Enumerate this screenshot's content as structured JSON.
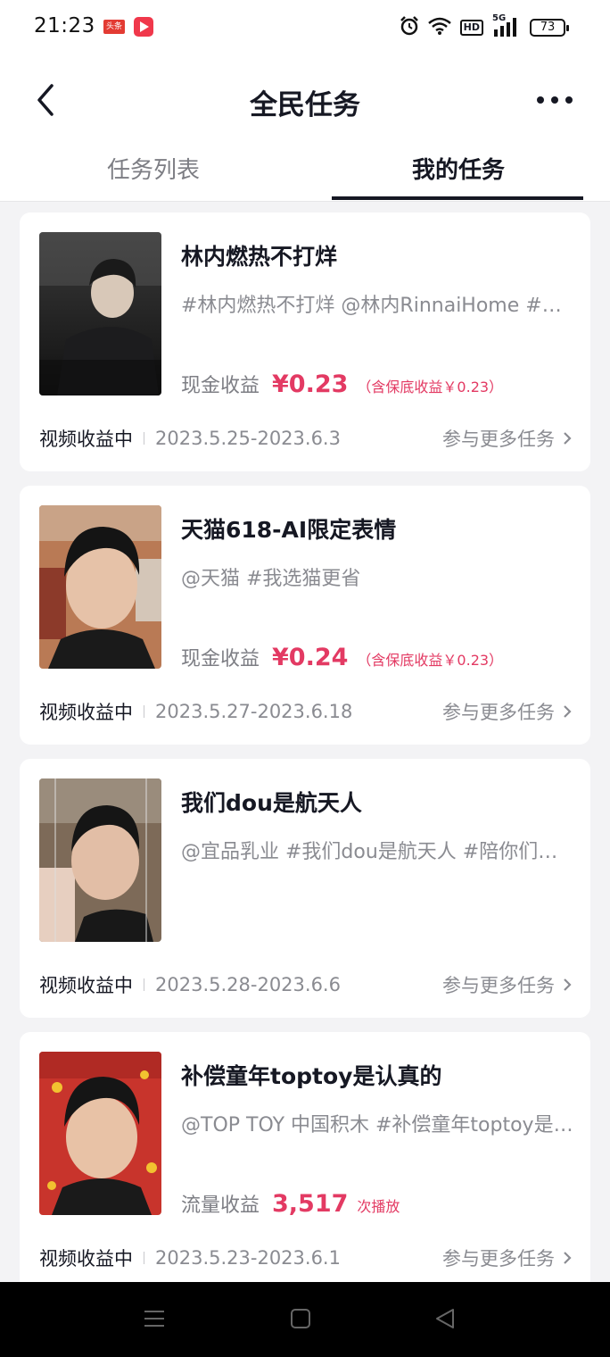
{
  "status_bar": {
    "time": "21:23",
    "app_icon_1_text": "头条",
    "signal": "5G",
    "hd": "HD",
    "battery": "73"
  },
  "header": {
    "title": "全民任务"
  },
  "tabs": [
    {
      "label": "任务列表",
      "active": false
    },
    {
      "label": "我的任务",
      "active": true
    }
  ],
  "tasks": [
    {
      "title": "林内燃热不打烊",
      "desc": "#林内燃热不打烊 @林内RinnaiHome #林内燃热不打烊",
      "earn_label": "现金收益",
      "earn_value": "¥0.23",
      "earn_note": "（含保底收益￥0.23）",
      "status": "视频收益中",
      "date_range": "2023.5.25-2023.6.3",
      "more_label": "参与更多任务"
    },
    {
      "title": "天猫618-AI限定表情",
      "desc": "@天猫 #我选猫更省",
      "earn_label": "现金收益",
      "earn_value": "¥0.24",
      "earn_note": "（含保底收益￥0.23）",
      "status": "视频收益中",
      "date_range": "2023.5.27-2023.6.18",
      "more_label": "参与更多任务"
    },
    {
      "title": "我们dou是航天人",
      "desc": "@宜品乳业 #我们dou是航天人 #陪你们一起",
      "earn_label": "",
      "earn_value": "",
      "earn_note": "",
      "status": "视频收益中",
      "date_range": "2023.5.28-2023.6.6",
      "more_label": "参与更多任务"
    },
    {
      "title": "补偿童年toptoy是认真的",
      "desc": "@TOP TOY 中国积木 #补偿童年toptoy是认真的",
      "earn_label": "流量收益",
      "earn_value": "3,517",
      "earn_note": "次播放",
      "status": "视频收益中",
      "date_range": "2023.5.23-2023.6.1",
      "more_label": "参与更多任务"
    }
  ],
  "colors": {
    "accent": "#e33a63",
    "text": "#161823",
    "secondary": "#8a8b91",
    "background": "#f3f3f5"
  }
}
